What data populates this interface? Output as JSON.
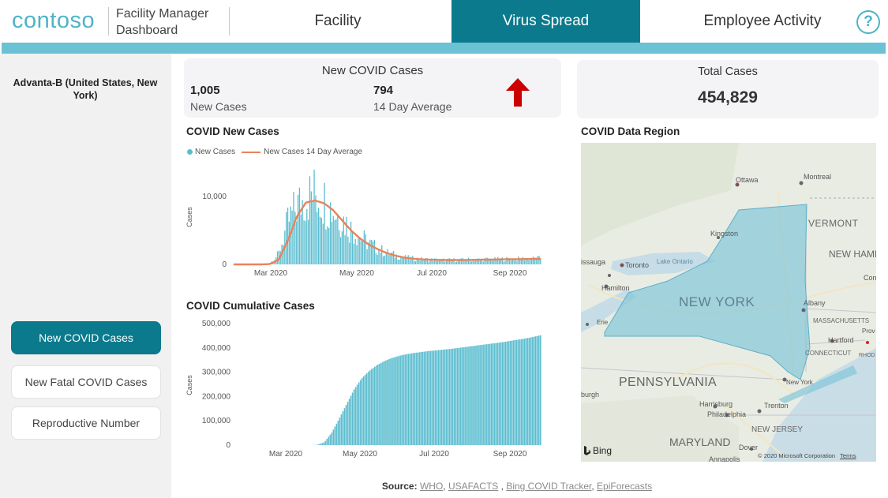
{
  "header": {
    "logo": "contoso",
    "title_line1": "Facility Manager",
    "title_line2": "Dashboard",
    "tabs": [
      {
        "label": "Facility"
      },
      {
        "label": "Virus Spread"
      },
      {
        "label": "Employee Activity"
      }
    ],
    "active_tab": "Virus Spread",
    "help_icon": "question-circle-icon",
    "help_glyph": "?"
  },
  "sidebar": {
    "location": "Advanta-B (United States, New York)",
    "buttons": [
      {
        "label": "New COVID Cases",
        "active": true
      },
      {
        "label": "New Fatal COVID Cases",
        "active": false
      },
      {
        "label": "Reproductive Number",
        "active": false
      }
    ]
  },
  "kpi": {
    "title": "New COVID Cases",
    "new_cases_value": "1,005",
    "new_cases_label": "New Cases",
    "avg_value": "794",
    "avg_label": "14 Day Average",
    "trend_icon": "arrow-up-icon",
    "trend_color": "#cc0000"
  },
  "total": {
    "title": "Total Cases",
    "value": "454,829"
  },
  "colors": {
    "accent": "#0b7a8c",
    "band": "#6bc2d4",
    "bar": "#5bbdd0",
    "line": "#e8835a"
  },
  "chart_data": [
    {
      "type": "bar",
      "title": "COVID New Cases",
      "ylabel": "Cases",
      "xlabel": "",
      "x_ticks": [
        "Mar 2020",
        "May 2020",
        "Jul 2020",
        "Sep 2020"
      ],
      "y_ticks": [
        "0",
        "10,000"
      ],
      "ylim": [
        0,
        13000
      ],
      "legend_position": "top-left",
      "series": [
        {
          "name": "New Cases",
          "style": "bar",
          "weekly_daily_values": [
            0,
            0,
            0,
            0,
            100,
            1500,
            6000,
            8500,
            9800,
            10500,
            9500,
            8000,
            6800,
            5200,
            4100,
            3100,
            2300,
            1700,
            1300,
            1000,
            850,
            750,
            700,
            650,
            650,
            650,
            700,
            700,
            750,
            750,
            800,
            800,
            850,
            850,
            900
          ]
        },
        {
          "name": "New Cases 14 Day Average",
          "style": "line",
          "weekly_values": [
            0,
            0,
            0,
            0,
            50,
            700,
            3500,
            7000,
            9100,
            9400,
            9000,
            8000,
            6500,
            5000,
            3800,
            2900,
            2200,
            1650,
            1250,
            980,
            820,
            730,
            680,
            650,
            640,
            640,
            660,
            680,
            700,
            720,
            740,
            760,
            780,
            800,
            820
          ]
        }
      ]
    },
    {
      "type": "bar",
      "title": "COVID Cumulative Cases",
      "ylabel": "Cases",
      "xlabel": "",
      "x_ticks": [
        "Mar 2020",
        "May 2020",
        "Jul 2020",
        "Sep 2020"
      ],
      "y_ticks": [
        "0",
        "100,000",
        "200,000",
        "300,000",
        "400,000",
        "500,000"
      ],
      "ylim": [
        0,
        500000
      ],
      "series": [
        {
          "name": "Cumulative Cases",
          "weekly_values": [
            0,
            0,
            0,
            0,
            1000,
            12000,
            52000,
            110000,
            170000,
            230000,
            275000,
            305000,
            328000,
            345000,
            358000,
            367000,
            374000,
            379000,
            383000,
            387000,
            390000,
            393000,
            396000,
            400000,
            404000,
            408000,
            412000,
            416000,
            420000,
            424000,
            429000,
            434000,
            439000,
            445000,
            452000
          ]
        }
      ]
    }
  ],
  "map": {
    "title": "COVID Data Region",
    "state_label": "NEW YORK",
    "labels": [
      "Ottawa",
      "Montreal",
      "VERMONT",
      "NEW HAMPSH",
      "Kingston",
      "Lake Ontario",
      "Toronto",
      "issauga",
      "Hamilton",
      "Albany",
      "MASSACHUSETTS",
      "Hartford",
      "CONNECTICUT",
      "New York",
      "Erie",
      "PENNSYLVANIA",
      "Harrisburg",
      "Philadelphia",
      "Trenton",
      "NEW JERSEY",
      "MARYLAND",
      "Dover",
      "Annapolis",
      "burgh",
      "Prov",
      "RHOD ISLAN",
      "Con"
    ],
    "provider": "Bing",
    "copyright": "© 2020 Microsoft Corporation",
    "terms": "Terms"
  },
  "footer": {
    "source_label": "Source:",
    "links": [
      "WHO",
      "USAFACTS",
      "Bing COVID Tracker",
      "EpiForecasts"
    ]
  }
}
